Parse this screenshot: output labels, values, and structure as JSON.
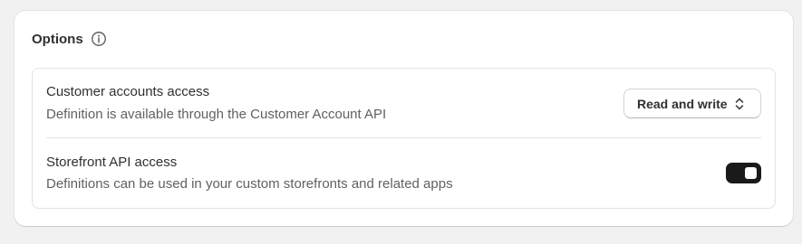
{
  "card": {
    "title": "Options",
    "info_icon": "info-circle-icon"
  },
  "rows": [
    {
      "title": "Customer accounts access",
      "description": "Definition is available through the Customer Account API",
      "control": {
        "type": "select",
        "value": "Read and write",
        "icon": "select-chevrons-icon"
      }
    },
    {
      "title": "Storefront API access",
      "description": "Definitions can be used in your custom storefronts and related apps",
      "control": {
        "type": "toggle",
        "checked": true
      }
    }
  ],
  "colors": {
    "page_background": "#f1f1f1",
    "card_background": "#ffffff",
    "toggle_on": "#1a1a1a",
    "text_primary": "#303030",
    "text_secondary": "#616161"
  }
}
